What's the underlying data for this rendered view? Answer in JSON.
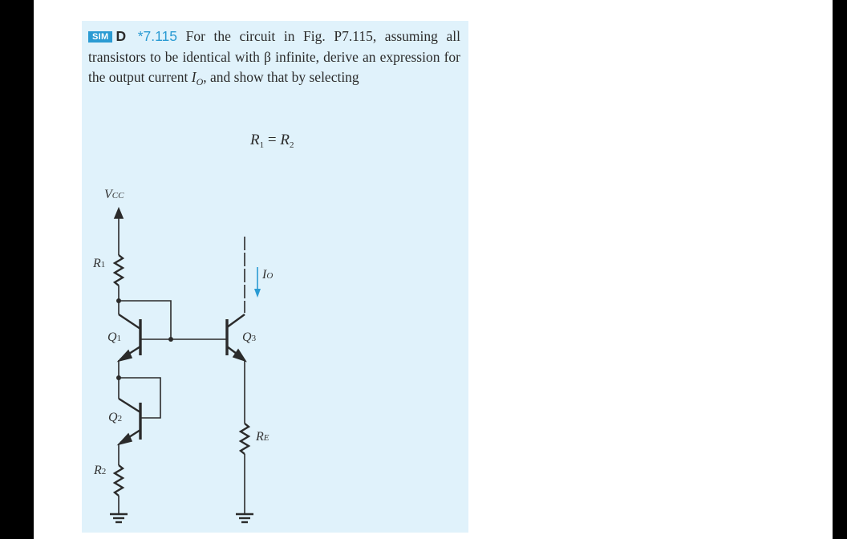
{
  "problem": {
    "badge": "SIM",
    "design_mark": "D",
    "number": "*7.115",
    "text_before_io": "For the circuit in Fig. P7.115, assuming all transistors to be identical with β infinite, derive an expression for the output current ",
    "io_symbol": "I",
    "io_subscript": "O",
    "text_after_io": ", and show that by selecting"
  },
  "equation": {
    "lhs": "R",
    "lhs_sub": "1",
    "op": "=",
    "rhs": "R",
    "rhs_sub": "2"
  },
  "circuit": {
    "labels": {
      "vcc": "V",
      "vcc_sub": "CC",
      "r1": "R",
      "r1_sub": "1",
      "r2": "R",
      "r2_sub": "2",
      "re": "R",
      "re_sub": "E",
      "q1": "Q",
      "q1_sub": "1",
      "q2": "Q",
      "q2_sub": "2",
      "q3": "Q",
      "q3_sub": "3",
      "io": "I",
      "io_sub": "O"
    },
    "colors": {
      "wire": "#2b2b2b",
      "current_arrow": "#2a9bd3",
      "panel": "#e0f2fb",
      "badge": "#2a9bd3"
    }
  }
}
